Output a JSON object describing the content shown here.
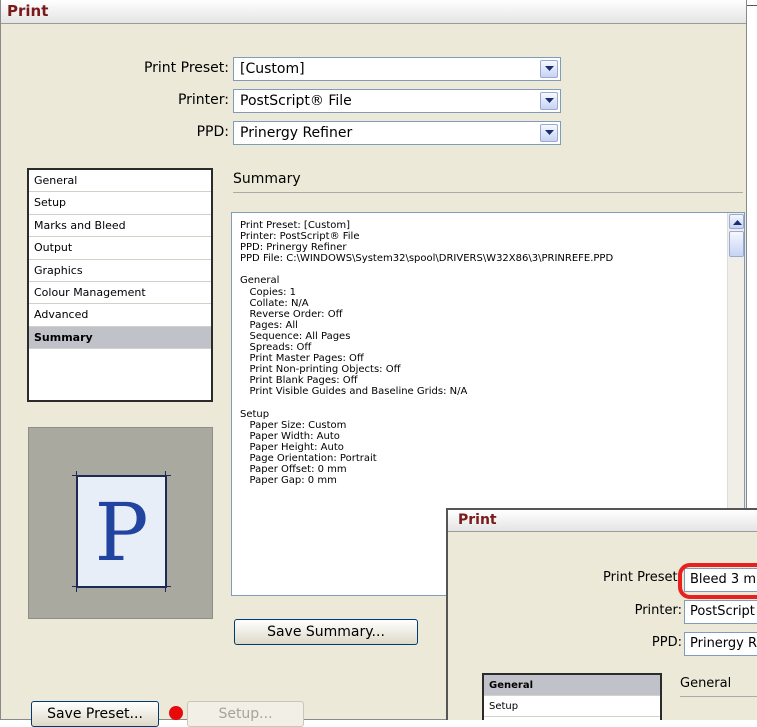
{
  "main": {
    "title": "Print",
    "preset_label": "Print Preset:",
    "preset_value": "[Custom]",
    "printer_label": "Printer:",
    "printer_value": "PostScript® File",
    "ppd_label": "PPD:",
    "ppd_value": "Prinergy Refiner",
    "categories": [
      "General",
      "Setup",
      "Marks and Bleed",
      "Output",
      "Graphics",
      "Colour Management",
      "Advanced",
      "Summary"
    ],
    "selected_category": "Summary",
    "preview_letter": "P",
    "summary_heading": "Summary",
    "summary_text": "Print Preset: [Custom]\nPrinter: PostScript® File\nPPD: Prinergy Refiner\nPPD File: C:\\WINDOWS\\System32\\spool\\DRIVERS\\W32X86\\3\\PRINREFE.PPD\n\nGeneral\n   Copies: 1\n   Collate: N/A\n   Reverse Order: Off\n   Pages: All\n   Sequence: All Pages\n   Spreads: Off\n   Print Master Pages: Off\n   Print Non-printing Objects: Off\n   Print Blank Pages: Off\n   Print Visible Guides and Baseline Grids: N/A\n\nSetup\n   Paper Size: Custom\n   Paper Width: Auto\n   Paper Height: Auto\n   Page Orientation: Portrait\n   Paper Offset: 0 mm\n   Paper Gap: 0 mm",
    "save_summary_label": "Save Summary...",
    "save_preset_label": "Save Preset...",
    "setup_label": "Setup..."
  },
  "inset": {
    "title": "Print",
    "preset_label": "Print Preset:",
    "preset_value": "Bleed 3 m",
    "printer_label": "Printer:",
    "printer_value": "PostScript",
    "ppd_label": "PPD:",
    "ppd_value": "Prinergy R",
    "categories": [
      "General",
      "Setup"
    ],
    "heading": "General"
  },
  "colors": {
    "dialog_bg": "#ece9d8",
    "title_color": "#7a1a1a",
    "highlight": "#e8201e",
    "selection": "#c1c1c9"
  }
}
